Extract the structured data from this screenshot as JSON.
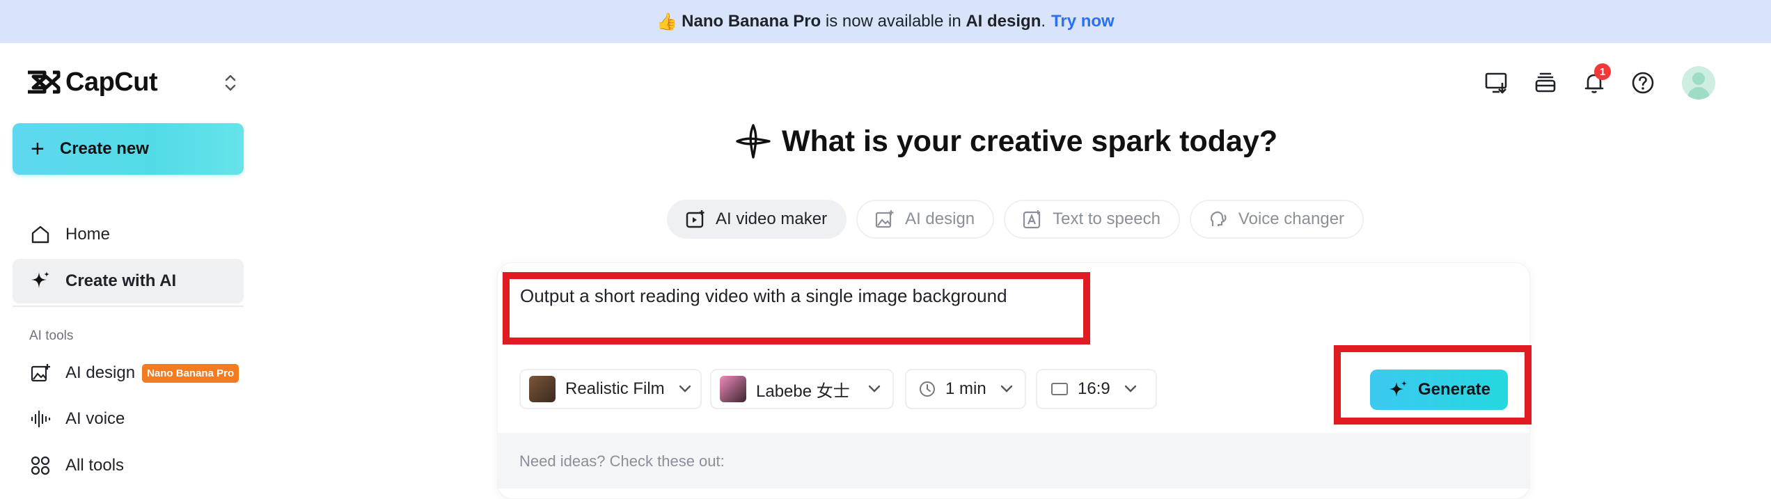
{
  "banner": {
    "emoji": "👍",
    "product": "Nano Banana Pro",
    "middle": " is now available in ",
    "feature": "AI design",
    "period": ".",
    "cta": "Try now"
  },
  "sidebar": {
    "logo_text": "CapCut",
    "create_new": "Create new",
    "items": [
      {
        "label": "Home",
        "icon": "home-icon"
      },
      {
        "label": "Create with AI",
        "icon": "sparkle-icon",
        "active": true
      }
    ],
    "section_label": "AI tools",
    "tools": [
      {
        "label": "AI design",
        "icon": "image-edit-icon",
        "badge": "Nano Banana Pro"
      },
      {
        "label": "AI voice",
        "icon": "waveform-icon"
      },
      {
        "label": "All tools",
        "icon": "grid-icon"
      }
    ]
  },
  "header": {
    "notification_count": "1"
  },
  "main": {
    "headline": "What is your creative spark today?",
    "tabs": [
      {
        "label": "AI video maker",
        "icon": "video-add-icon",
        "active": true
      },
      {
        "label": "AI design",
        "icon": "image-add-icon"
      },
      {
        "label": "Text to speech",
        "icon": "text-image-icon"
      },
      {
        "label": "Voice changer",
        "icon": "voice-changer-icon"
      }
    ],
    "prompt_text": "Output a short reading video with a single image background",
    "options": {
      "style": "Realistic Film",
      "voice": "Labebe 女士",
      "duration": "1 min",
      "ratio": "16:9"
    },
    "generate_label": "Generate",
    "ideas_label": "Need ideas? Check these out:"
  },
  "colors": {
    "banner_bg": "#d9e4fb",
    "accent_cyan": "#52dbe6",
    "link_blue": "#2a6ff5",
    "badge_orange": "#f47b20",
    "highlight_red": "#e01b22"
  }
}
